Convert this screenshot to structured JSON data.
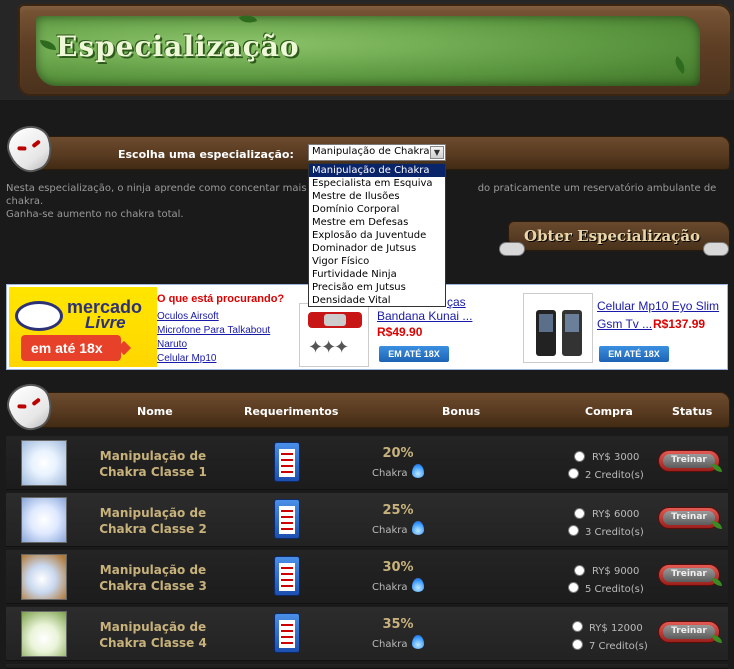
{
  "banner": {
    "title": "Especialização"
  },
  "selector": {
    "label": "Escolha uma especialização:",
    "selected": "Manipulação de Chakra",
    "options": [
      "Manipulação de Chakra",
      "Especialista em Esquiva",
      "Mestre de Ilusões",
      "Domínio Corporal",
      "Mestre em Defesas",
      "Explosão da Juventude",
      "Dominador de Jutsus",
      "Vigor Físico",
      "Furtividade Ninja",
      "Precisão em Jutsus",
      "Densidade Vital"
    ]
  },
  "description": {
    "line1_start": "Nesta especialização, o ninja aprende como concentar mais cha",
    "line1_end": "do praticamente um reservatório ambulante de chakra.",
    "line2": "Ganha-se aumento no chakra total."
  },
  "obter_button": {
    "label": "Obter Especialização"
  },
  "ad": {
    "brand_line1": "mercado",
    "brand_line2": "Livre",
    "promo": "em até 18x",
    "search_question": "O que está procurando?",
    "links": [
      "Oculos Airsoft",
      "Microfone Para Talkabout",
      "Naruto",
      "Celular Mp10"
    ],
    "products": [
      {
        "title_partial": "ças",
        "title_line2": "Bandana Kunai ...",
        "price": "R$49.90",
        "button": "EM ATÉ 18X"
      },
      {
        "title_line1": "Celular Mp10 Eyo Slim",
        "title_line2": "Gsm Tv ...",
        "price": "R$137.99",
        "button": "EM ATÉ 18X"
      }
    ]
  },
  "table": {
    "headers": {
      "nome": "Nome",
      "requerimentos": "Requerimentos",
      "bonus": "Bonus",
      "compra": "Compra",
      "status": "Status"
    },
    "rows": [
      {
        "name_line1": "Manipulação de",
        "name_line2": "Chakra Classe 1",
        "pct": "20%",
        "stat": "Chakra",
        "price_ry": "RY$ 3000",
        "price_cred": "2 Credito(s)",
        "action": "Treinar"
      },
      {
        "name_line1": "Manipulação de",
        "name_line2": "Chakra Classe 2",
        "pct": "25%",
        "stat": "Chakra",
        "price_ry": "RY$ 6000",
        "price_cred": "3 Credito(s)",
        "action": "Treinar"
      },
      {
        "name_line1": "Manipulação de",
        "name_line2": "Chakra Classe 3",
        "pct": "30%",
        "stat": "Chakra",
        "price_ry": "RY$ 9000",
        "price_cred": "5 Credito(s)",
        "action": "Treinar"
      },
      {
        "name_line1": "Manipulação de",
        "name_line2": "Chakra Classe 4",
        "pct": "35%",
        "stat": "Chakra",
        "price_ry": "RY$ 12000",
        "price_cred": "7 Credito(s)",
        "action": "Treinar"
      }
    ]
  },
  "icons": {
    "mask": "white-anbu-mask-icon",
    "requirements": "checklist-icon",
    "bonus": "blue-chakra-flame-icon",
    "train": "treinar-button-icon"
  },
  "colors": {
    "background": "#1a1a1a",
    "banner_green": "#5e9a42",
    "wood": "#5e3f25",
    "gold_text": "#c8b27c",
    "selected_option": "#0a246a",
    "ad_price_red": "#dd0000",
    "ad_link_blue": "#1a1aaa"
  }
}
